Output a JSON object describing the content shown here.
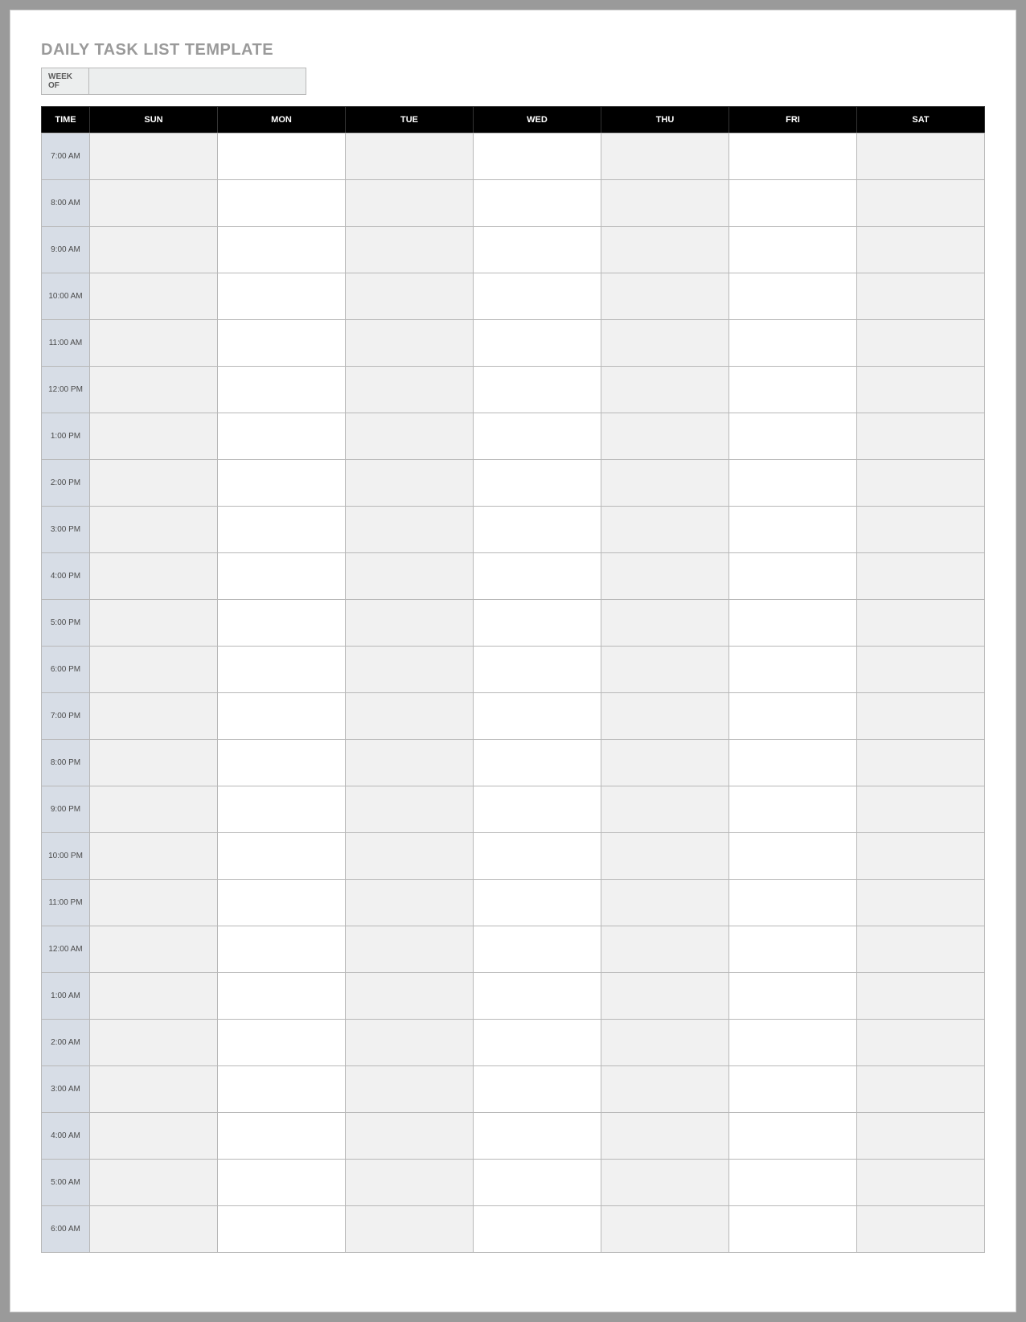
{
  "title": "DAILY TASK LIST TEMPLATE",
  "week_of_label": "WEEK OF",
  "week_of_value": "",
  "headers": {
    "time": "TIME",
    "days": [
      "SUN",
      "MON",
      "TUE",
      "WED",
      "THU",
      "FRI",
      "SAT"
    ]
  },
  "shaded_days": [
    0,
    2,
    4,
    6
  ],
  "times": [
    "7:00 AM",
    "8:00 AM",
    "9:00 AM",
    "10:00 AM",
    "11:00 AM",
    "12:00 PM",
    "1:00 PM",
    "2:00 PM",
    "3:00 PM",
    "4:00 PM",
    "5:00 PM",
    "6:00 PM",
    "7:00 PM",
    "8:00 PM",
    "9:00 PM",
    "10:00 PM",
    "11:00 PM",
    "12:00 AM",
    "1:00 AM",
    "2:00 AM",
    "3:00 AM",
    "4:00 AM",
    "5:00 AM",
    "6:00 AM"
  ],
  "cells": {}
}
